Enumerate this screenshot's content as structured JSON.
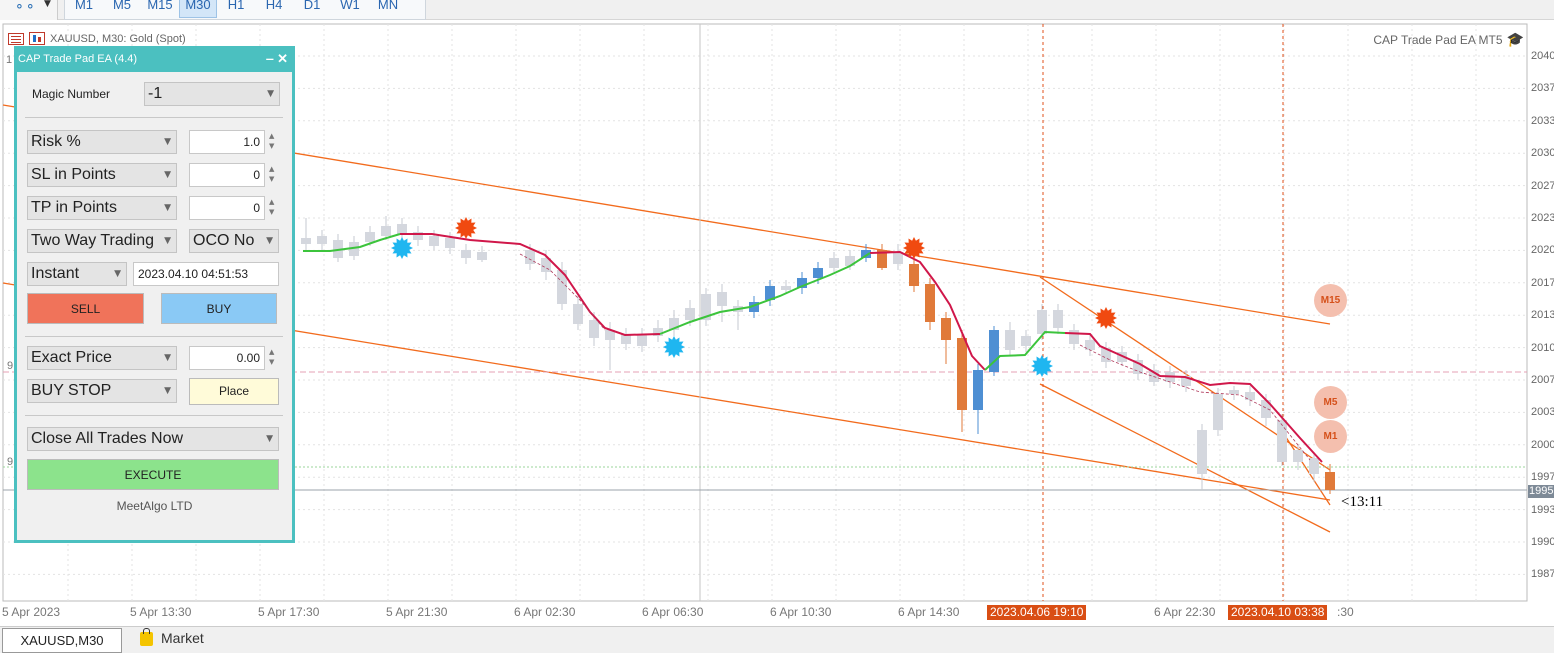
{
  "toolbar": {
    "timeframes": [
      "M1",
      "M5",
      "M15",
      "M30",
      "H1",
      "H4",
      "D1",
      "W1",
      "MN"
    ],
    "active_timeframe": "M30"
  },
  "chart": {
    "symbol_info": "XAUUSD, M30:  Gold (Spot)",
    "ea_label": "CAP Trade Pad EA MT5",
    "price_labels": [
      "2040",
      "2037",
      "2033",
      "2030",
      "2027",
      "2023",
      "2020",
      "2017",
      "2013",
      "2010",
      "2007",
      "2003",
      "2000",
      "1997",
      "1993",
      "1990",
      "1987"
    ],
    "current_price_label": "1995",
    "time_labels": [
      "5 Apr 2023",
      "5 Apr 13:30",
      "5 Apr 17:30",
      "5 Apr 21:30",
      "6 Apr 02:30",
      "6 Apr 06:30",
      "6 Apr 10:30",
      "6 Apr 14:30",
      "6 Apr 22:30",
      ":30"
    ],
    "time_tag_1": "2023.04.06 19:10",
    "time_tag_2": "2023.04.10 03:38",
    "countdown": "<13:11",
    "badges": [
      "M15",
      "M5",
      "M1"
    ],
    "left_edge_labels": [
      "1",
      "9",
      "9"
    ]
  },
  "panel": {
    "title": "CAP Trade Pad EA (4.4)",
    "buttons_glyph": "‒  ✕",
    "magic_label": "Magic Number",
    "magic_value": "-1",
    "risk_label": "Risk %",
    "risk_value": "1.0",
    "sl_label": "SL in Points",
    "sl_value": "0",
    "tp_label": "TP in Points",
    "tp_value": "0",
    "two_way": "Two Way Trading",
    "oco": "OCO No",
    "instant": "Instant",
    "datetime": "2023.04.10 04:51:53",
    "sell": "SELL",
    "buy": "BUY",
    "exact_price": "Exact Price",
    "exact_price_value": "0.00",
    "order_type": "BUY STOP",
    "place": "Place",
    "close_all": "Close All Trades Now",
    "execute": "EXECUTE",
    "footer": "MeetAlgo LTD"
  },
  "bottom": {
    "active_tab": "XAUUSD,M30",
    "market_tab": "Market"
  },
  "colors": {
    "panel_accent": "#4bc0c0",
    "sell": "#f0735a",
    "buy": "#8ac9f5",
    "execute": "#8ce38c",
    "place": "#fffbd9",
    "up_candle": "#4e8fd3",
    "down_candle": "#e07a3a",
    "trend_line": "#f26b1d",
    "ma_down": "#d0174a",
    "ma_up": "#3cc43c"
  }
}
